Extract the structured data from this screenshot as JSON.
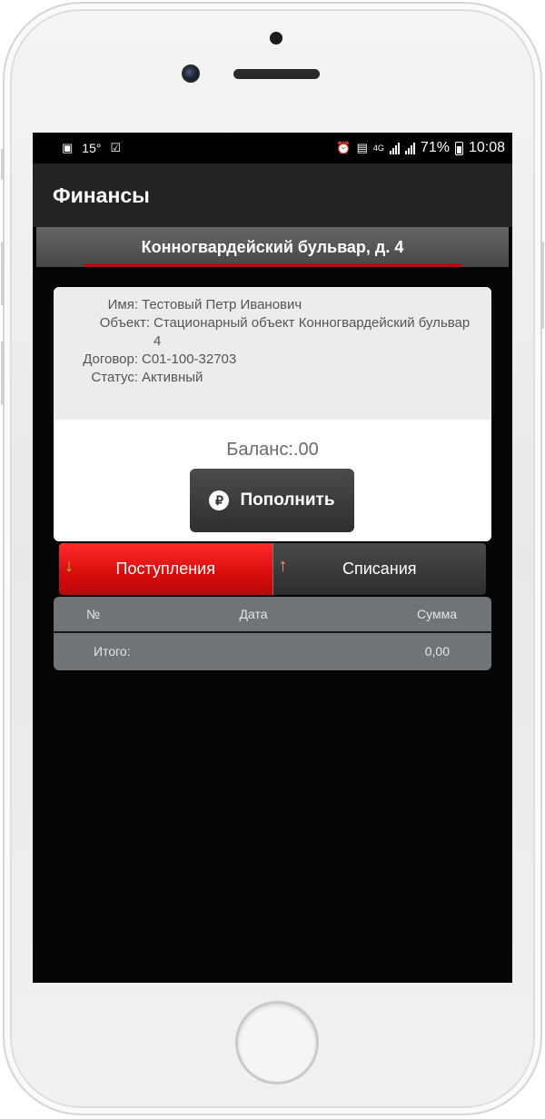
{
  "status_bar": {
    "temperature": "15°",
    "network": "4G",
    "battery": "71%",
    "time": "10:08"
  },
  "app_bar": {
    "title": "Финансы"
  },
  "address": {
    "text": "Конногвардейский бульвар, д. 4"
  },
  "info": {
    "name_label": "Имя:",
    "name_value": "Тестовый Петр Иванович",
    "object_label": "Объект:",
    "object_value": "Стационарный объект Конногвардейский бульвар 4",
    "contract_label": "Договор:",
    "contract_value": "С01-100-32703",
    "status_label": "Статус:",
    "status_value": "Активный"
  },
  "balance": {
    "text": "Баланс:.00"
  },
  "topup_button": {
    "label": "Пополнить"
  },
  "tabs": {
    "incoming": "Поступления",
    "outgoing": "Списания"
  },
  "table": {
    "headers": [
      "№",
      "Дата",
      "Сумма"
    ],
    "total_label": "Итого:",
    "total_value": "0,00"
  }
}
